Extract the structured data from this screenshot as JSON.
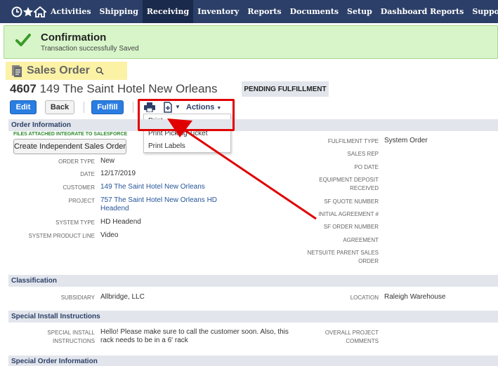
{
  "nav": {
    "items": [
      {
        "label": "Activities"
      },
      {
        "label": "Shipping"
      },
      {
        "label": "Receiving"
      },
      {
        "label": "Inventory"
      },
      {
        "label": "Reports"
      },
      {
        "label": "Documents"
      },
      {
        "label": "Setup"
      },
      {
        "label": "Dashboard Reports"
      },
      {
        "label": "Support"
      }
    ],
    "active": "Receiving"
  },
  "confirmation": {
    "title": "Confirmation",
    "message": "Transaction successfully Saved"
  },
  "record": {
    "type_label": "Sales Order",
    "number": "4607",
    "name": "149 The Saint Hotel New Orleans",
    "status": "PENDING FULFILLMENT"
  },
  "toolbar": {
    "edit_label": "Edit",
    "back_label": "Back",
    "fulfill_label": "Fulfill",
    "actions_label": "Actions",
    "print_menu": [
      "Print",
      "Print Picking Ticket",
      "Print Labels"
    ]
  },
  "order_info": {
    "section_title": "Order Information",
    "sf_files_label": "FILES ATTACHED INTEGRATE TO SALESFORCE",
    "create_button": "Create Independent Sales Order",
    "left_fields": [
      {
        "label": "ORDER TYPE",
        "value": "New"
      },
      {
        "label": "DATE",
        "value": "12/17/2019"
      },
      {
        "label": "CUSTOMER",
        "value": "149 The Saint Hotel New Orleans"
      },
      {
        "label": "PROJECT",
        "value_line1": "757 The Saint Hotel New Orleans HD",
        "value_line2": "Headend"
      },
      {
        "label": "SYSTEM TYPE",
        "value": "HD Headend"
      },
      {
        "label": "SYSTEM PRODUCT LINE",
        "value": "Video"
      }
    ],
    "right_fields": [
      {
        "label": "FULFILMENT TYPE",
        "value": "System Order"
      },
      {
        "label": "SALES REP",
        "value": ""
      },
      {
        "label": "PO DATE",
        "value": ""
      },
      {
        "label_line1": "EQUIPMENT DEPOSIT",
        "label_line2": "RECEIVED",
        "value": ""
      },
      {
        "label": "SF QUOTE NUMBER",
        "value": ""
      },
      {
        "label": "INITIAL AGREEMENT #",
        "value": ""
      },
      {
        "label": "SF ORDER NUMBER",
        "value": ""
      },
      {
        "label": "AGREEMENT",
        "value": ""
      },
      {
        "label_line1": "NETSUITE PARENT SALES",
        "label_line2": "ORDER",
        "value": ""
      }
    ]
  },
  "classification": {
    "section_title": "Classification",
    "subsidiary_label": "SUBSIDIARY",
    "subsidiary_value": "Allbridge, LLC",
    "location_label": "LOCATION",
    "location_value": "Raleigh Warehouse"
  },
  "special_install": {
    "section_title": "Special Install Instructions",
    "label_line1": "SPECIAL INSTALL",
    "label_line2": "INSTRUCTIONS",
    "value_line1": "Hello! Please make sure to call the customer soon. Also, this",
    "value_line2": "rack needs to be in a 6' rack",
    "comments_label_line1": "OVERALL PROJECT",
    "comments_label_line2": "COMMENTS"
  },
  "special_order": {
    "section_title": "Special Order Information"
  },
  "colors": {
    "nav_bg": "#2c3f68",
    "confirm_bg": "#d8f5c9",
    "button_blue": "#2a7de1",
    "annotation_red": "#e00000"
  },
  "icons": [
    "clock-icon",
    "star-icon",
    "home-icon",
    "checkmark-icon",
    "document-icon",
    "search-icon",
    "print-icon",
    "new-document-icon",
    "chevron-down-icon"
  ]
}
